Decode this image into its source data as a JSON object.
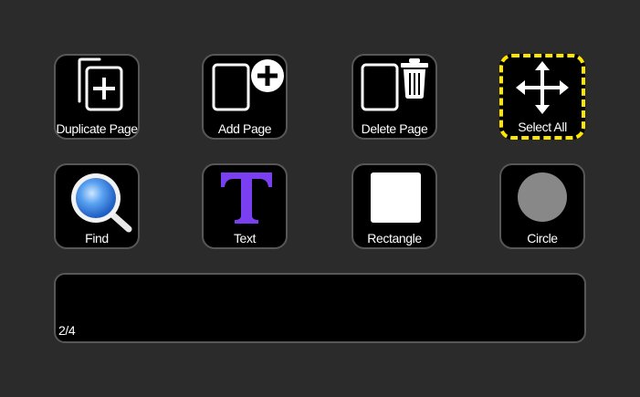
{
  "keys": {
    "duplicate_page": {
      "label": "Duplicate Page",
      "icon": "duplicate-page-icon"
    },
    "add_page": {
      "label": "Add Page",
      "icon": "add-page-icon"
    },
    "delete_page": {
      "label": "Delete Page",
      "icon": "trash-icon"
    },
    "select_all": {
      "label": "Select All",
      "icon": "move-arrows-icon",
      "selected": true
    },
    "find": {
      "label": "Find",
      "icon": "magnifier-icon"
    },
    "text": {
      "label": "Text",
      "icon": "text-t-icon"
    },
    "rectangle": {
      "label": "Rectangle",
      "icon": "rectangle-icon"
    },
    "circle": {
      "label": "Circle",
      "icon": "circle-icon"
    }
  },
  "info_bar": {
    "page_indicator": "2/4"
  },
  "colors": {
    "background": "#2b2b2b",
    "key_background": "#000000",
    "key_border": "#575757",
    "selection_dash": "#ffe600",
    "text_icon": "#7b3ff2",
    "circle_fill": "#888888",
    "find_lens": "#4a90e2"
  }
}
